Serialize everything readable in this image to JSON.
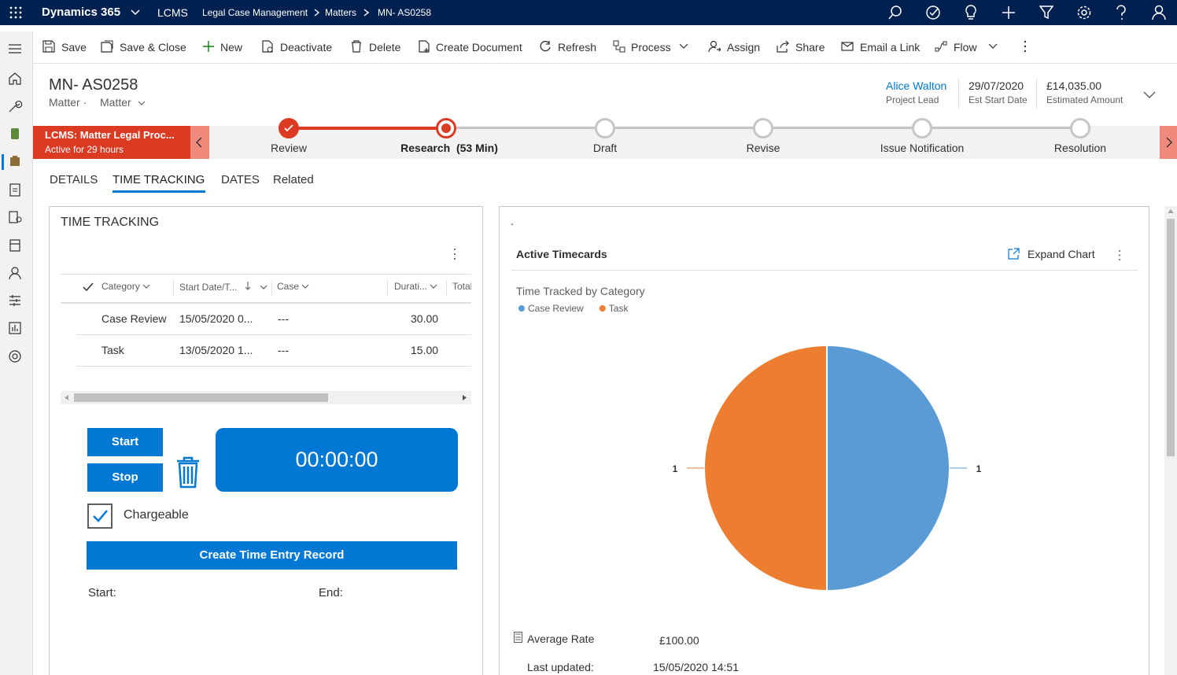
{
  "topbar": {
    "app_name": "Dynamics 365",
    "area": "LCMS",
    "breadcrumb": [
      "Legal Case Management",
      "Matters",
      "MN- AS0258"
    ]
  },
  "commands": {
    "save": "Save",
    "save_close": "Save & Close",
    "new": "New",
    "deactivate": "Deactivate",
    "delete": "Delete",
    "create_document": "Create Document",
    "refresh": "Refresh",
    "process": "Process",
    "assign": "Assign",
    "share": "Share",
    "email_link": "Email a Link",
    "flow": "Flow"
  },
  "header": {
    "title": "MN- AS0258",
    "entity": "Matter",
    "form": "Matter",
    "fields": [
      {
        "value": "Alice Walton",
        "label": "Project Lead"
      },
      {
        "value": "29/07/2020",
        "label": "Est Start Date"
      },
      {
        "value": "£14,035.00",
        "label": "Estimated Amount"
      }
    ]
  },
  "bpf": {
    "name": "LCMS: Matter Legal Proc...",
    "active_for": "Active for 29 hours",
    "stages": [
      {
        "label": "Review",
        "state": "done"
      },
      {
        "label": "Research",
        "duration": "(53 Min)",
        "state": "active"
      },
      {
        "label": "Draft",
        "state": "todo"
      },
      {
        "label": "Revise",
        "state": "todo"
      },
      {
        "label": "Issue Notification",
        "state": "todo"
      },
      {
        "label": "Resolution",
        "state": "todo"
      }
    ]
  },
  "tabs": [
    "DETAILS",
    "TIME TRACKING",
    "DATES",
    "Related"
  ],
  "time_tracking": {
    "section_title": "TIME TRACKING",
    "columns": [
      "Category",
      "Start Date/T...",
      "Case",
      "Durati...",
      "Total"
    ],
    "rows": [
      {
        "category": "Case Review",
        "start": "15/05/2020 0...",
        "case": "---",
        "duration": "30.00"
      },
      {
        "category": "Task",
        "start": "13/05/2020 1...",
        "case": "---",
        "duration": "15.00"
      }
    ],
    "start_label": "Start",
    "stop_label": "Stop",
    "timer": "00:00:00",
    "chargeable_label": "Chargeable",
    "chargeable_checked": true,
    "create_label": "Create Time Entry Record",
    "start_field": "Start:",
    "end_field": "End:"
  },
  "chart_panel": {
    "dot": ".",
    "title": "Active Timecards",
    "expand_label": "Expand Chart",
    "average_rate_label": "Average Rate",
    "average_rate_value": "£100.00",
    "last_updated_label": "Last updated:",
    "last_updated_value": "15/05/2020 14:51"
  },
  "chart_data": {
    "type": "pie",
    "title": "Time Tracked by Category",
    "categories": [
      "Case Review",
      "Task"
    ],
    "values": [
      1,
      1
    ],
    "colors": [
      "#5b9bd5",
      "#ed7d31"
    ],
    "data_labels": [
      "1",
      "1"
    ],
    "legend_position": "top-left"
  },
  "colors": {
    "nav": "#002050",
    "accent": "#0078d4",
    "bpf_active": "#db3a23"
  }
}
